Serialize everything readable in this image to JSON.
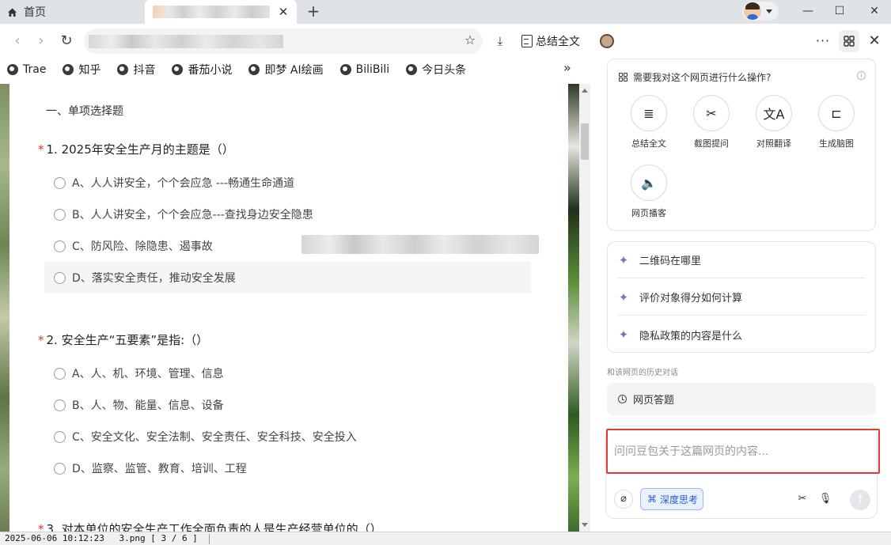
{
  "tabs": {
    "home_label": "首页",
    "close_symbol": "✕",
    "new_tab_symbol": "+"
  },
  "window": {
    "minimize": "—",
    "maximize": "☐",
    "close": "✕"
  },
  "toolbar": {
    "back": "‹",
    "forward": "›",
    "reload": "↻",
    "bookmark_star": "☆",
    "download": "⤓",
    "summarize_label": "总结全文",
    "more": "···",
    "close_panel": "✕"
  },
  "bookmarks": {
    "items": [
      {
        "label": "Trae"
      },
      {
        "label": "知乎"
      },
      {
        "label": "抖音"
      },
      {
        "label": "番茄小说"
      },
      {
        "label": "即梦 AI绘画"
      },
      {
        "label": "BiliBili"
      },
      {
        "label": "今日头条"
      }
    ],
    "overflow": "»"
  },
  "quiz": {
    "section_title": "一、单项选择题",
    "required_mark": "*",
    "questions": [
      {
        "title": "1. 2025年安全生产月的主题是（）",
        "options": [
          "A、人人讲安全，个个会应急 ---畅通生命通道",
          "B、人人讲安全，个个会应急---查找身边安全隐患",
          "C、防风险、除隐患、遏事故",
          "D、落实安全责任，推动安全发展"
        ]
      },
      {
        "title": "2. 安全生产“五要素”是指:（）",
        "options": [
          "A、人、机、环境、管理、信息",
          "B、人、物、能量、信息、设备",
          "C、安全文化、安全法制、安全责任、安全科技、安全投入",
          "D、监察、监管、教育、培训、工程"
        ]
      },
      {
        "title": "3. 对本单位的安全生产工作全面负责的人是生产经营单位的（）"
      }
    ]
  },
  "panel": {
    "ops_header": "需要我对这个网页进行什么操作?",
    "ops_info": "i",
    "ops": [
      {
        "label": "总结全文",
        "glyph": "≣"
      },
      {
        "label": "截图提问",
        "glyph": "✂"
      },
      {
        "label": "对照翻译",
        "glyph": "文A"
      },
      {
        "label": "生成脑图",
        "glyph": "⊏"
      },
      {
        "label": "网页播客",
        "glyph": "🔈"
      }
    ],
    "suggestions": [
      "二维码在哪里",
      "评价对象得分如何计算",
      "隐私政策的内容是什么"
    ],
    "spark_glyph": "✦",
    "history_label": "和该网页的历史对话",
    "history_item": "网页答题",
    "input_placeholder": "问问豆包关于这篇网页的内容...",
    "deep_think_label": "深度思考",
    "deep_think_glyph": "⌘",
    "attach_glyph": "⌀",
    "scissors_glyph": "✂",
    "mic_glyph": "🎙",
    "send_glyph": "↑"
  },
  "statusbar": {
    "timestamp": "2025-06-06 10:12:23",
    "file": "3.png [ 3 / 6 ]"
  },
  "colors": {
    "required": "#e0332b",
    "highlight_border": "#e53935",
    "accent": "#2a5bd7"
  }
}
